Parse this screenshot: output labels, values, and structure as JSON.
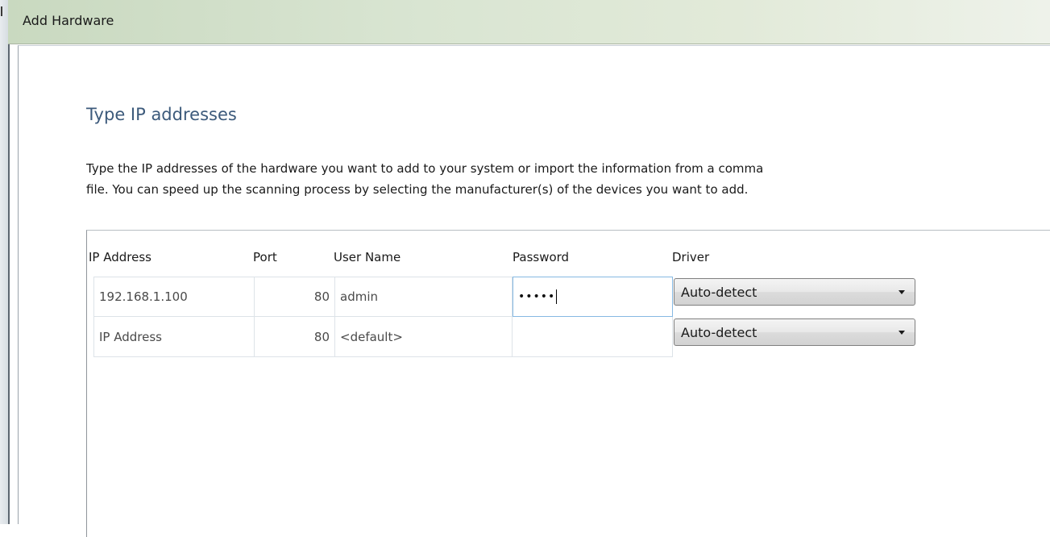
{
  "window": {
    "title": "Add Hardware"
  },
  "page": {
    "heading": "Type IP addresses",
    "description_line1": "Type the IP addresses of the hardware you want to add to your system or import the information from a comma",
    "description_line2": "file. You can speed up the scanning process by selecting the manufacturer(s) of the devices you want to add."
  },
  "grid": {
    "columns": [
      "IP Address",
      "Port",
      "User Name",
      "Password",
      "Driver"
    ],
    "rows": [
      {
        "ip": "192.168.1.100",
        "port": "80",
        "user": "admin",
        "password": "•••••",
        "driver": "Auto-detect"
      },
      {
        "ip": "IP Address",
        "port": "80",
        "user": "<default>",
        "password": "",
        "driver": "Auto-detect"
      }
    ]
  },
  "icons": {
    "dropdown_arrow": "chevron-down-icon"
  }
}
